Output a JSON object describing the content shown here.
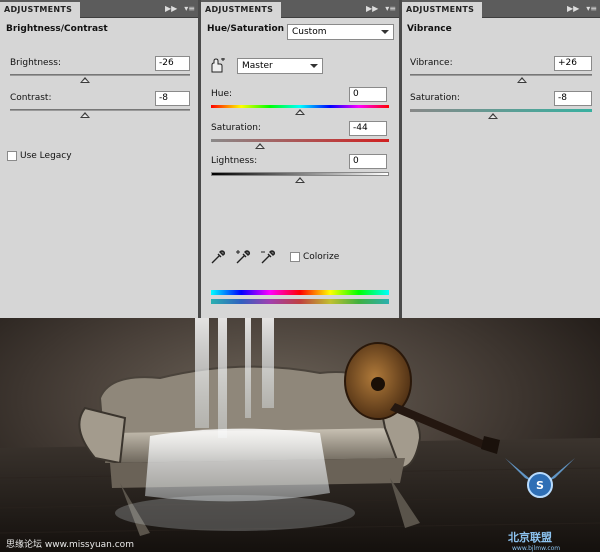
{
  "panels": [
    {
      "tab": "ADJUSTMENTS",
      "title": "Brightness/Contrast",
      "brightness": {
        "label": "Brightness:",
        "value": "-26"
      },
      "contrast": {
        "label": "Contrast:",
        "value": "-8"
      },
      "use_legacy": "Use Legacy"
    },
    {
      "tab": "ADJUSTMENTS",
      "title": "Hue/Saturation",
      "preset": "Custom",
      "channel": "Master",
      "hue": {
        "label": "Hue:",
        "value": "0"
      },
      "saturation": {
        "label": "Saturation:",
        "value": "-44"
      },
      "lightness": {
        "label": "Lightness:",
        "value": "0"
      },
      "colorize": "Colorize"
    },
    {
      "tab": "ADJUSTMENTS",
      "title": "Vibrance",
      "vibrance": {
        "label": "Vibrance:",
        "value": "+26"
      },
      "saturation": {
        "label": "Saturation:",
        "value": "-8"
      }
    }
  ],
  "footer": {
    "left_text": "思缘论坛 www.missyuan.com",
    "logo_text": "北京联盟",
    "logo_sub": "www.bjlmw.com"
  }
}
